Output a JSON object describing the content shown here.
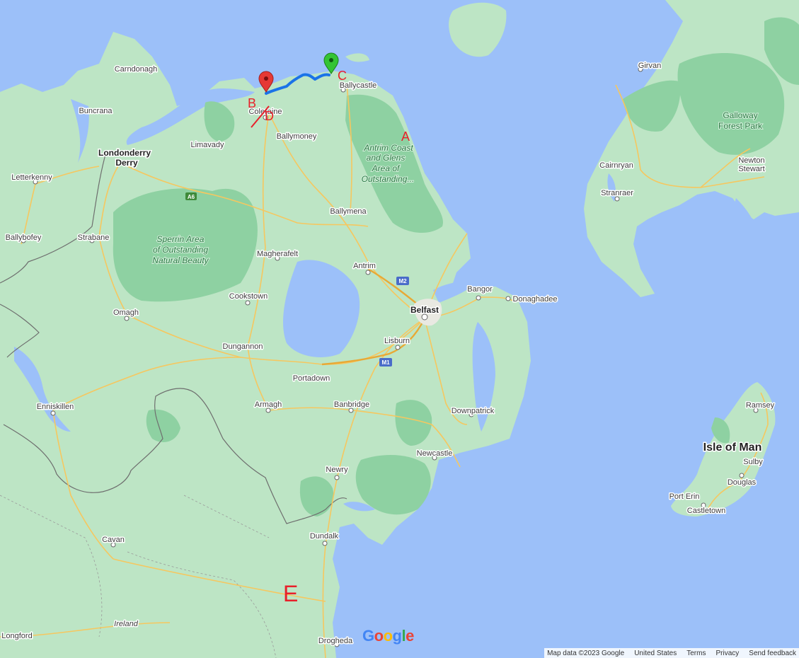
{
  "map": {
    "places": [
      {
        "id": "carndonagh",
        "name": "Carndonagh"
      },
      {
        "id": "buncrana",
        "name": "Buncrana"
      },
      {
        "id": "londonderry",
        "name": "Londonderry"
      },
      {
        "id": "derry",
        "name": "Derry"
      },
      {
        "id": "letterkenny",
        "name": "Letterkenny"
      },
      {
        "id": "limavady",
        "name": "Limavady"
      },
      {
        "id": "coleraine",
        "name": "Coleraine"
      },
      {
        "id": "ballymoney",
        "name": "Ballymoney"
      },
      {
        "id": "ballycastle",
        "name": "Ballycastle"
      },
      {
        "id": "ballymena",
        "name": "Ballymena"
      },
      {
        "id": "ballybofey",
        "name": "Ballybofey"
      },
      {
        "id": "strabane",
        "name": "Strabane"
      },
      {
        "id": "magherafelt",
        "name": "Magherafelt"
      },
      {
        "id": "antrim",
        "name": "Antrim"
      },
      {
        "id": "bangor",
        "name": "Bangor"
      },
      {
        "id": "donaghadee",
        "name": "Donaghadee"
      },
      {
        "id": "belfast",
        "name": "Belfast"
      },
      {
        "id": "cookstown",
        "name": "Cookstown"
      },
      {
        "id": "omagh",
        "name": "Omagh"
      },
      {
        "id": "lisburn",
        "name": "Lisburn"
      },
      {
        "id": "dungannon",
        "name": "Dungannon"
      },
      {
        "id": "portadown",
        "name": "Portadown"
      },
      {
        "id": "enniskillen",
        "name": "Enniskillen"
      },
      {
        "id": "armagh",
        "name": "Armagh"
      },
      {
        "id": "banbridge",
        "name": "Banbridge"
      },
      {
        "id": "downpatrick",
        "name": "Downpatrick"
      },
      {
        "id": "newcastle",
        "name": "Newcastle"
      },
      {
        "id": "newry",
        "name": "Newry"
      },
      {
        "id": "cavan",
        "name": "Cavan"
      },
      {
        "id": "dundalk",
        "name": "Dundalk"
      },
      {
        "id": "ireland",
        "name": "Ireland"
      },
      {
        "id": "longford",
        "name": "Longford"
      },
      {
        "id": "drogheda",
        "name": "Drogheda"
      },
      {
        "id": "girvan",
        "name": "Girvan"
      },
      {
        "id": "cairnryan",
        "name": "Cairnryan"
      },
      {
        "id": "stranraer",
        "name": "Stranraer"
      },
      {
        "id": "newton_stewart_1",
        "name": "Newton"
      },
      {
        "id": "newton_stewart_2",
        "name": "Stewart"
      },
      {
        "id": "ramsey",
        "name": "Ramsey"
      },
      {
        "id": "sulby",
        "name": "Sulby"
      },
      {
        "id": "douglas",
        "name": "Douglas"
      },
      {
        "id": "port_erin",
        "name": "Port Erin"
      },
      {
        "id": "castletown",
        "name": "Castletown"
      }
    ],
    "regions": {
      "isle_of_man": "Isle of Man",
      "antrim_coast": [
        "Antrim Coast",
        "and Glens",
        "Area of",
        "Outstanding..."
      ],
      "sperrin": [
        "Sperrin Area",
        "of Outstanding",
        "Natural Beauty"
      ],
      "galloway": [
        "Galloway",
        "Forest Park"
      ]
    },
    "road_shields": [
      "A6",
      "M2",
      "M1"
    ]
  },
  "annotations": {
    "a": "A",
    "b": "B",
    "c": "C",
    "d": "D",
    "e": "E"
  },
  "markers": {
    "start_color": "#e53935",
    "end_color": "#34c434",
    "route_color": "#1a73e8"
  },
  "footer": {
    "map_data": "Map data ©2023 Google",
    "region": "United States",
    "terms": "Terms",
    "privacy": "Privacy",
    "feedback": "Send feedback"
  },
  "logo": {
    "g1": "G",
    "o1": "o",
    "o2": "o",
    "g2": "g",
    "l": "l",
    "e": "e"
  }
}
